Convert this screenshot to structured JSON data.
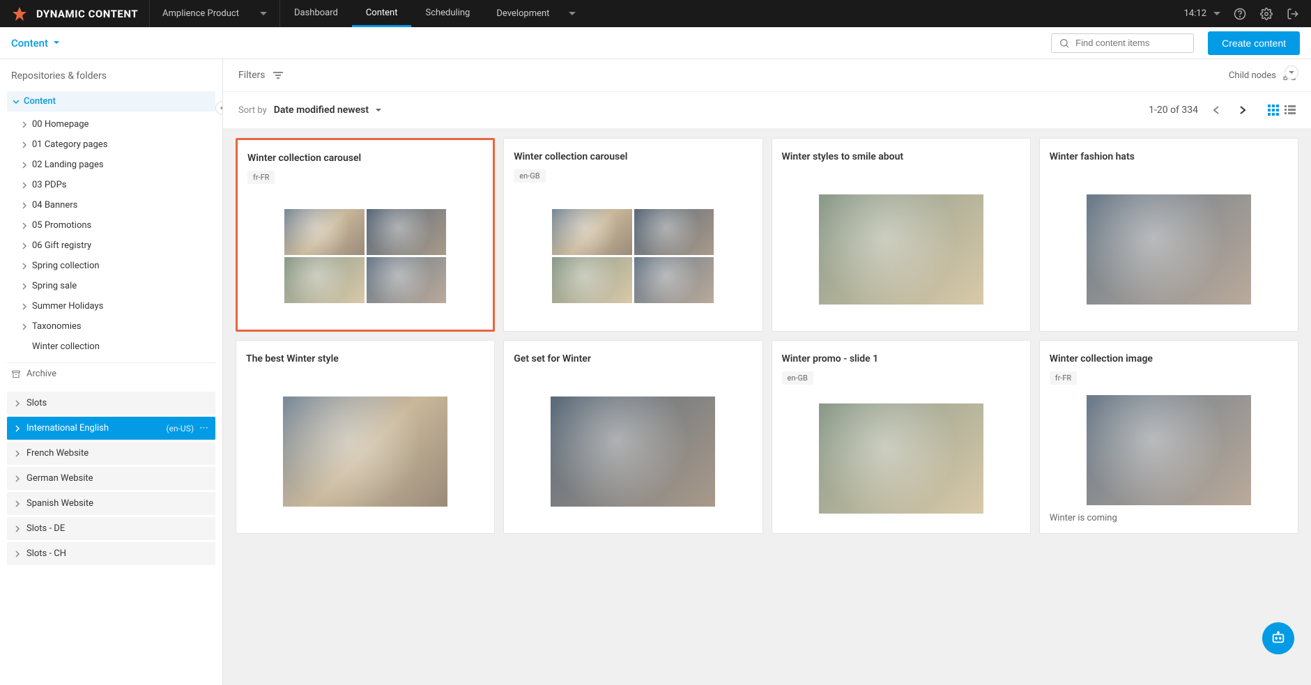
{
  "brand": "DYNAMIC CONTENT",
  "product_selector": "Amplience Product",
  "top_nav": [
    "Dashboard",
    "Content",
    "Scheduling"
  ],
  "environment": "Development",
  "clock": "14:12",
  "subbar": {
    "content_label": "Content",
    "search_placeholder": "Find content items",
    "create_label": "Create content"
  },
  "sidebar": {
    "title": "Repositories & folders",
    "root": "Content",
    "folders": [
      "00 Homepage",
      "01 Category pages",
      "02 Landing pages",
      "03 PDPs",
      "04 Banners",
      "05 Promotions",
      "06 Gift registry",
      "Spring collection",
      "Spring sale",
      "Summer Holidays",
      "Taxonomies",
      "Winter collection"
    ],
    "archive": "Archive",
    "repos": [
      {
        "label": "Slots",
        "code": ""
      },
      {
        "label": "International English",
        "code": "(en-US)"
      },
      {
        "label": "French Website",
        "code": ""
      },
      {
        "label": "German Website",
        "code": ""
      },
      {
        "label": "Spanish Website",
        "code": ""
      },
      {
        "label": "Slots - DE",
        "code": ""
      },
      {
        "label": "Slots - CH",
        "code": ""
      }
    ]
  },
  "panel": {
    "filters": "Filters",
    "child_nodes": "Child nodes",
    "sort_by": "Sort by",
    "sort_value": "Date modified newest",
    "range": "1-20 of 334"
  },
  "cards": [
    {
      "title": "Winter collection carousel",
      "locale": "fr-FR",
      "type": "grid4",
      "selected": true
    },
    {
      "title": "Winter collection carousel",
      "locale": "en-GB",
      "type": "grid4"
    },
    {
      "title": "Winter styles to smile about",
      "locale": "",
      "type": "single"
    },
    {
      "title": "Winter fashion hats",
      "locale": "",
      "type": "single"
    },
    {
      "title": "The best Winter style",
      "locale": "",
      "type": "single"
    },
    {
      "title": "Get set for Winter",
      "locale": "",
      "type": "single"
    },
    {
      "title": "Winter promo - slide 1",
      "locale": "en-GB",
      "type": "single"
    },
    {
      "title": "Winter collection image",
      "locale": "fr-FR",
      "type": "single",
      "caption": "Winter is coming"
    }
  ]
}
